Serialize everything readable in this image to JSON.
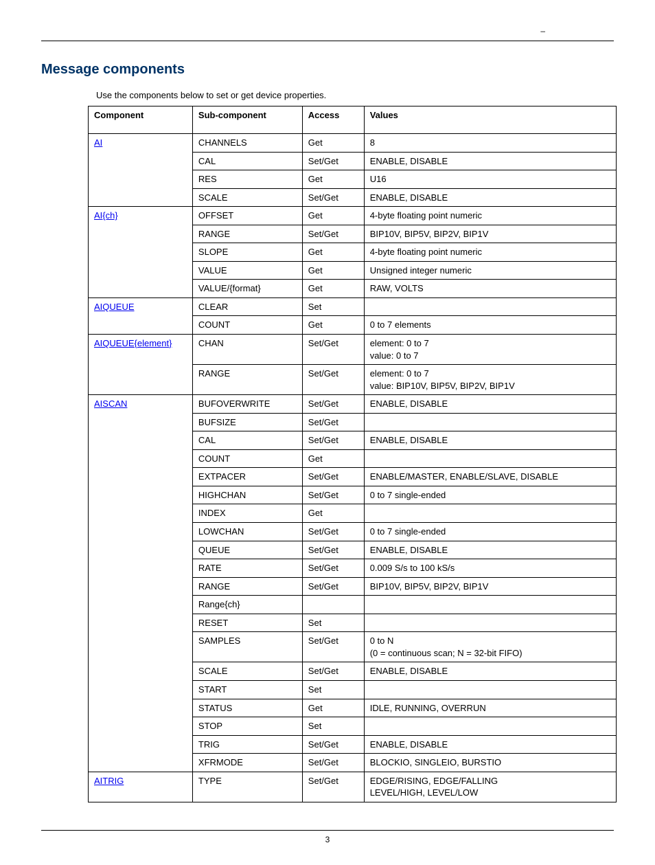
{
  "header": {
    "dash": "–"
  },
  "section_title": "Message components",
  "intro": "Use the components below to set or get device properties.",
  "columns": {
    "c1": "Component",
    "c2": "Sub-component",
    "c3": "Access",
    "c4": "Values"
  },
  "components": {
    "ai": "AI",
    "ai_ch": "AI{ch}",
    "aiqueue": "AIQUEUE",
    "aiqueue_el": "AIQUEUE{element}",
    "aiscan": "AISCAN",
    "aitrig": "AITRIG"
  },
  "rows": {
    "ai_channels": {
      "sub": "CHANNELS",
      "access": "Get",
      "vals": "8"
    },
    "ai_cal": {
      "sub": "CAL",
      "access": "Set/Get",
      "vals": "ENABLE, DISABLE"
    },
    "ai_res": {
      "sub": "RES",
      "access": "Get",
      "vals": "U16"
    },
    "ai_scale": {
      "sub": "SCALE",
      "access": "Set/Get",
      "vals": "ENABLE, DISABLE"
    },
    "aich_offset": {
      "sub": "OFFSET",
      "access": "Get",
      "vals": "4-byte floating point numeric"
    },
    "aich_range": {
      "sub": "RANGE",
      "access": "Set/Get",
      "vals": "BIP10V, BIP5V, BIP2V, BIP1V"
    },
    "aich_slope": {
      "sub": "SLOPE",
      "access": "Get",
      "vals": "4-byte floating point numeric"
    },
    "aich_value": {
      "sub": "VALUE",
      "access": "Get",
      "vals": "Unsigned integer numeric"
    },
    "aich_valuefmt": {
      "sub": "VALUE/{format}",
      "access": "Get",
      "vals": "RAW, VOLTS"
    },
    "aiq_clear": {
      "sub": "CLEAR",
      "access": "Set",
      "vals": ""
    },
    "aiq_count": {
      "sub": "COUNT",
      "access": "Get",
      "vals": "0 to 7 elements"
    },
    "aiqe_chan": {
      "sub": "CHAN",
      "access": "Set/Get",
      "vals": "element: 0 to 7\nvalue: 0 to 7"
    },
    "aiqe_range": {
      "sub": "RANGE",
      "access": "Set/Get",
      "vals": "element: 0 to 7\nvalue: BIP10V, BIP5V, BIP2V, BIP1V"
    },
    "sc_bufover": {
      "sub": "BUFOVERWRITE",
      "access": "Set/Get",
      "vals": "ENABLE, DISABLE"
    },
    "sc_bufsize": {
      "sub": "BUFSIZE",
      "access": "Set/Get",
      "vals": ""
    },
    "sc_cal": {
      "sub": "CAL",
      "access": "Set/Get",
      "vals": "ENABLE, DISABLE"
    },
    "sc_count": {
      "sub": "COUNT",
      "access": "Get",
      "vals": ""
    },
    "sc_extpacer": {
      "sub": "EXTPACER",
      "access": "Set/Get",
      "vals": "ENABLE/MASTER, ENABLE/SLAVE, DISABLE"
    },
    "sc_highchan": {
      "sub": "HIGHCHAN",
      "access": "Set/Get",
      "vals": "0 to 7 single-ended"
    },
    "sc_index": {
      "sub": "INDEX",
      "access": "Get",
      "vals": ""
    },
    "sc_lowchan": {
      "sub": "LOWCHAN",
      "access": "Set/Get",
      "vals": "0 to 7 single-ended"
    },
    "sc_queue": {
      "sub": "QUEUE",
      "access": "Set/Get",
      "vals": "ENABLE, DISABLE"
    },
    "sc_rate": {
      "sub": "RATE",
      "access": "Set/Get",
      "vals": "0.009 S/s to 100 kS/s"
    },
    "sc_range": {
      "sub": "RANGE",
      "access": "Set/Get",
      "vals": "BIP10V, BIP5V, BIP2V, BIP1V"
    },
    "sc_rangech": {
      "sub": "Range{ch}",
      "access": "",
      "vals": ""
    },
    "sc_reset": {
      "sub": "RESET",
      "access": "Set",
      "vals": ""
    },
    "sc_samples": {
      "sub": "SAMPLES",
      "access": "Set/Get",
      "vals": "0 to N\n(0 = continuous scan; N = 32-bit FIFO)"
    },
    "sc_scale": {
      "sub": "SCALE",
      "access": "Set/Get",
      "vals": "ENABLE, DISABLE"
    },
    "sc_start": {
      "sub": "START",
      "access": "Set",
      "vals": ""
    },
    "sc_status": {
      "sub": "STATUS",
      "access": "Get",
      "vals": "IDLE, RUNNING, OVERRUN"
    },
    "sc_stop": {
      "sub": "STOP",
      "access": "Set",
      "vals": ""
    },
    "sc_trig": {
      "sub": "TRIG",
      "access": "Set/Get",
      "vals": "ENABLE, DISABLE"
    },
    "sc_xfrmode": {
      "sub": "XFRMODE",
      "access": "Set/Get",
      "vals": "BLOCKIO, SINGLEIO, BURSTIO"
    },
    "trig_type": {
      "sub": "TYPE",
      "access": "Set/Get",
      "vals": "EDGE/RISING, EDGE/FALLING\nLEVEL/HIGH, LEVEL/LOW"
    }
  },
  "footer": {
    "page": "3"
  }
}
